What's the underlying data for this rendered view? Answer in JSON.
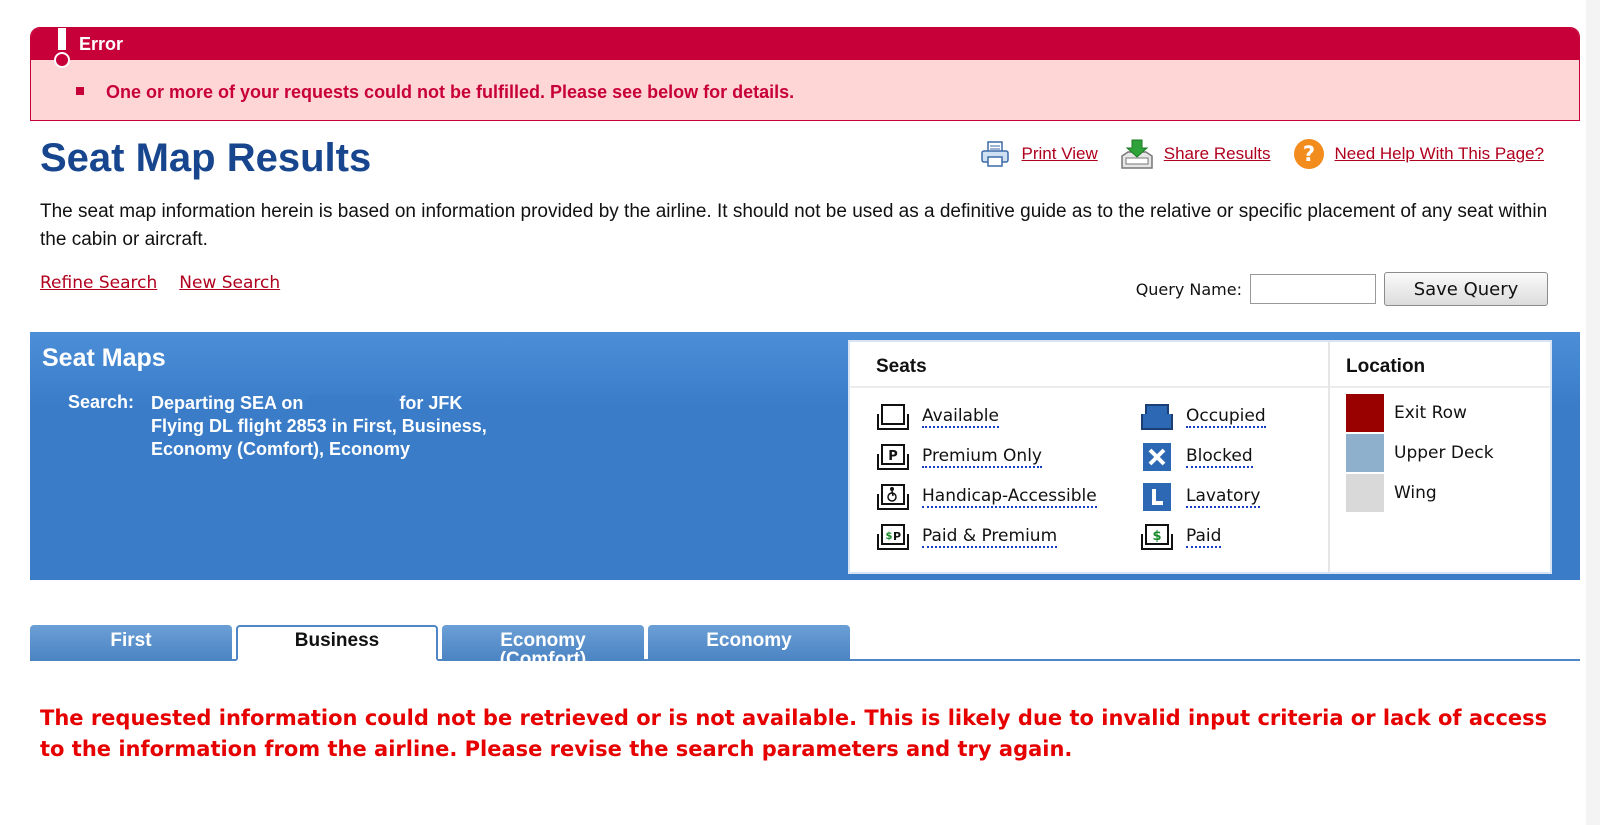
{
  "error": {
    "title": "Error",
    "message": "One or more of your requests could not be fulfilled. Please see below for details."
  },
  "header": {
    "title": "Seat Map Results",
    "links": {
      "print": "Print View",
      "share": "Share Results",
      "help": "Need Help With This Page?"
    }
  },
  "intro": "The seat map information herein is based on information provided by the airline. It should not be used as a definitive guide as to the relative or specific placement of any seat within the cabin or aircraft.",
  "search_links": {
    "refine": "Refine Search",
    "new": "New Search"
  },
  "query": {
    "label": "Query Name:",
    "value": "",
    "save_label": "Save Query"
  },
  "panel": {
    "title": "Seat Maps",
    "search_label": "Search:",
    "line1_a": "Departing SEA on",
    "line1_b": "for JFK",
    "line2": "Flying DL flight 2853 in First, Business,",
    "line3": "Economy (Comfort), Economy"
  },
  "legend": {
    "seats_title": "Seats",
    "location_title": "Location",
    "seats": [
      "Available",
      "Premium Only",
      "Handicap-Accessible",
      "Paid & Premium",
      "Occupied",
      "Blocked",
      "Lavatory",
      "Paid"
    ],
    "locations": [
      {
        "label": "Exit Row",
        "color": "#990000"
      },
      {
        "label": "Upper Deck",
        "color": "#8fb0cd"
      },
      {
        "label": "Wing",
        "color": "#d9d9d9"
      }
    ]
  },
  "tabs": [
    {
      "label": "First"
    },
    {
      "label": "Business",
      "active": true
    },
    {
      "label": "Economy",
      "sub": "(Comfort)"
    },
    {
      "label": "Economy"
    }
  ],
  "retrieve_error": "The requested information could not be retrieved or is not available. This is likely due to invalid input criteria or lack of access to the information from the airline. Please revise the search parameters and try again.",
  "colors": {
    "error_red": "#c8003a",
    "title_blue": "#17468e",
    "panel_blue": "#3a7cc8",
    "link_red": "#b0001e",
    "alert_red": "#e60000"
  }
}
